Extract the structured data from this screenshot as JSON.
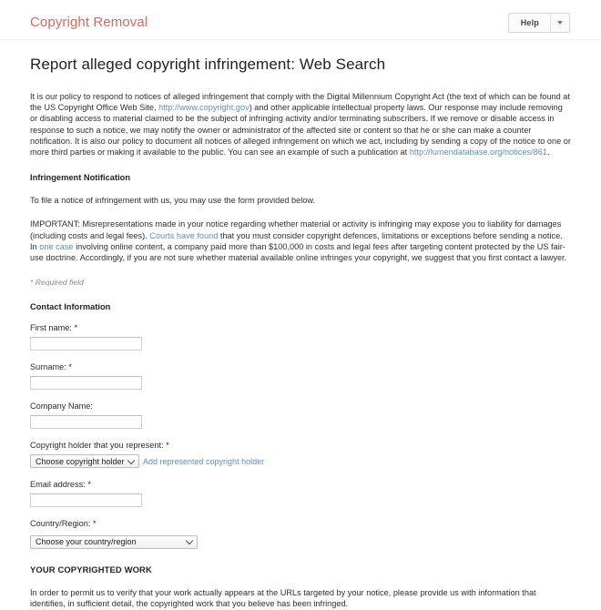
{
  "header": {
    "brand": "Copyright Removal",
    "help_label": "Help",
    "caret_icon": "chevron-down-icon"
  },
  "page": {
    "title": "Report alleged copyright infringement: Web Search",
    "intro": {
      "part1": "It is our policy to respond to notices of alleged infringement that comply with the Digital Millennium Copyright Act (the text of which can be found at the US Copyright Office Web Site, ",
      "link1": "http://www.copyright.gov",
      "part2": ") and other applicable intellectual property laws. Our response may include removing or disabling access to material claimed to be the subject of infringing activity and/or terminating subscribers. If we remove or disable access in response to such a notice, we may notify the owner or administrator of the affected site or content so that he or she can make a counter notification. It is also our policy to document all notices of alleged infringement on which we act, including by sending a copy of the notice to one or more third parties or making it available to the public. You can see an example of such a publication at ",
      "link2": "http://lumendatabase.org/notices/861",
      "part3": "."
    },
    "infringement_heading": "Infringement Notification",
    "file_notice_text": "To file a notice of infringement with us, you may use the form provided below.",
    "important": {
      "part1": "IMPORTANT: Misrepresentations made in your notice regarding whether material or activity is infringing may expose you to liability for damages (including costs and legal fees). ",
      "link1": "Courts have found",
      "part2": " that you must consider copyright defences, limitations or exceptions before sending a notice. In ",
      "link2": "one case",
      "part3": " involving online content, a company paid more than $100,000 in costs and legal fees after targeting content protected by the US fair-use doctrine. Accordingly, if you are not sure whether material available online infringes your copyright, we suggest that you first contact a lawyer."
    },
    "required_field_note": "* Required field",
    "contact_heading": "Contact Information",
    "fields": {
      "first_name": {
        "label": "First name: *",
        "value": "",
        "placeholder": ""
      },
      "surname": {
        "label": "Surname: *",
        "value": "",
        "placeholder": ""
      },
      "company_name": {
        "label": "Company Name:",
        "value": "",
        "placeholder": ""
      },
      "copyright_holder": {
        "label": "Copyright holder that you represent: *",
        "selected": "Choose copyright holder",
        "add_link": "Add represented copyright holder"
      },
      "email_address": {
        "label": "Email address: *",
        "value": "",
        "placeholder": ""
      },
      "country_region": {
        "label": "Country/Region: *",
        "selected": "Choose your country/region"
      }
    },
    "copyrighted_work_heading": "YOUR COPYRIGHTED WORK",
    "copyrighted_work_text": "In order to permit us to verify that your work actually appears at the URLs targeted by your notice, please provide us with information that identifies, in sufficient detail, the copyrighted work that you believe has been infringed."
  },
  "colors": {
    "brand": "#d9695f",
    "link": "#5b8fd4",
    "text": "#303030"
  }
}
